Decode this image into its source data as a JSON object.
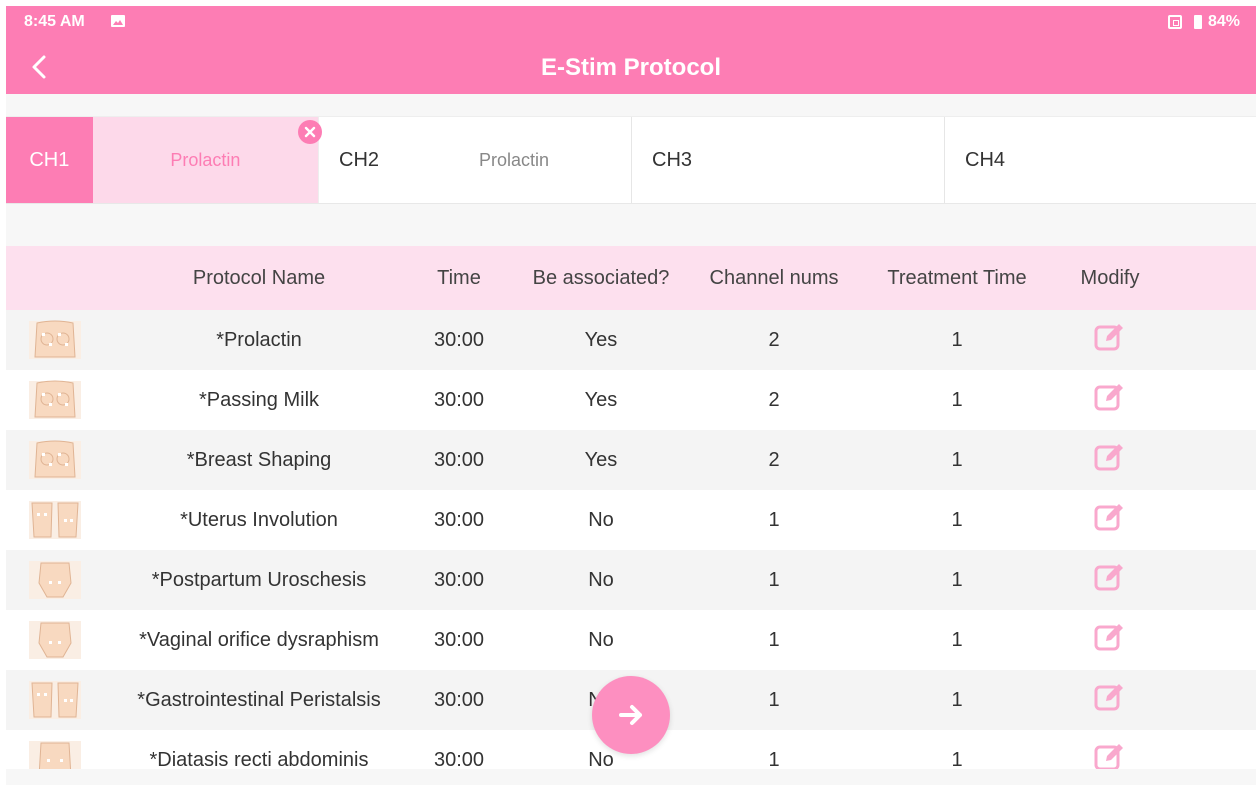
{
  "status_bar": {
    "time": "8:45 AM",
    "battery": "84%"
  },
  "header": {
    "title": "E-Stim Protocol"
  },
  "channels": [
    {
      "label": "CH1",
      "protocol": "Prolactin",
      "selected": true
    },
    {
      "label": "CH2",
      "protocol": "Prolactin",
      "selected": false
    },
    {
      "label": "CH3",
      "protocol": "",
      "selected": false
    },
    {
      "label": "CH4",
      "protocol": "",
      "selected": false
    }
  ],
  "table": {
    "columns": [
      "",
      "Protocol Name",
      "Time",
      "Be associated?",
      "Channel nums",
      "Treatment Time",
      "Modify"
    ],
    "rows": [
      {
        "image": "breast-electrodes-icon",
        "name": "*Prolactin",
        "time": "30:00",
        "associated": "Yes",
        "channels": "2",
        "treatment": "1"
      },
      {
        "image": "breast-electrodes-icon",
        "name": "*Passing Milk",
        "time": "30:00",
        "associated": "Yes",
        "channels": "2",
        "treatment": "1"
      },
      {
        "image": "breast-electrodes-icon",
        "name": "*Breast Shaping",
        "time": "30:00",
        "associated": "Yes",
        "channels": "2",
        "treatment": "1"
      },
      {
        "image": "abdomen-back-electrodes-icon",
        "name": "*Uterus Involution",
        "time": "30:00",
        "associated": "No",
        "channels": "1",
        "treatment": "1"
      },
      {
        "image": "pelvis-electrodes-icon",
        "name": "*Postpartum Uroschesis",
        "time": "30:00",
        "associated": "No",
        "channels": "1",
        "treatment": "1"
      },
      {
        "image": "pelvis-electrodes-icon",
        "name": "*Vaginal orifice dysraphism",
        "time": "30:00",
        "associated": "No",
        "channels": "1",
        "treatment": "1"
      },
      {
        "image": "abdomen-back-electrodes-icon",
        "name": "*Gastrointestinal Peristalsis",
        "time": "30:00",
        "associated": "No",
        "channels": "1",
        "treatment": "1"
      },
      {
        "image": "abdomen-electrodes-icon",
        "name": "*Diatasis recti abdominis",
        "time": "30:00",
        "associated": "No",
        "channels": "1",
        "treatment": "1"
      }
    ]
  },
  "colors": {
    "accent": "#fd7db4",
    "accent_light": "#fdd9ea",
    "header_row": "#fde0ee",
    "edit_icon": "#f9a8cd"
  },
  "icons": {
    "back": "chevron-left-icon",
    "remove": "close-icon",
    "edit": "edit-icon",
    "next": "arrow-right-icon"
  }
}
